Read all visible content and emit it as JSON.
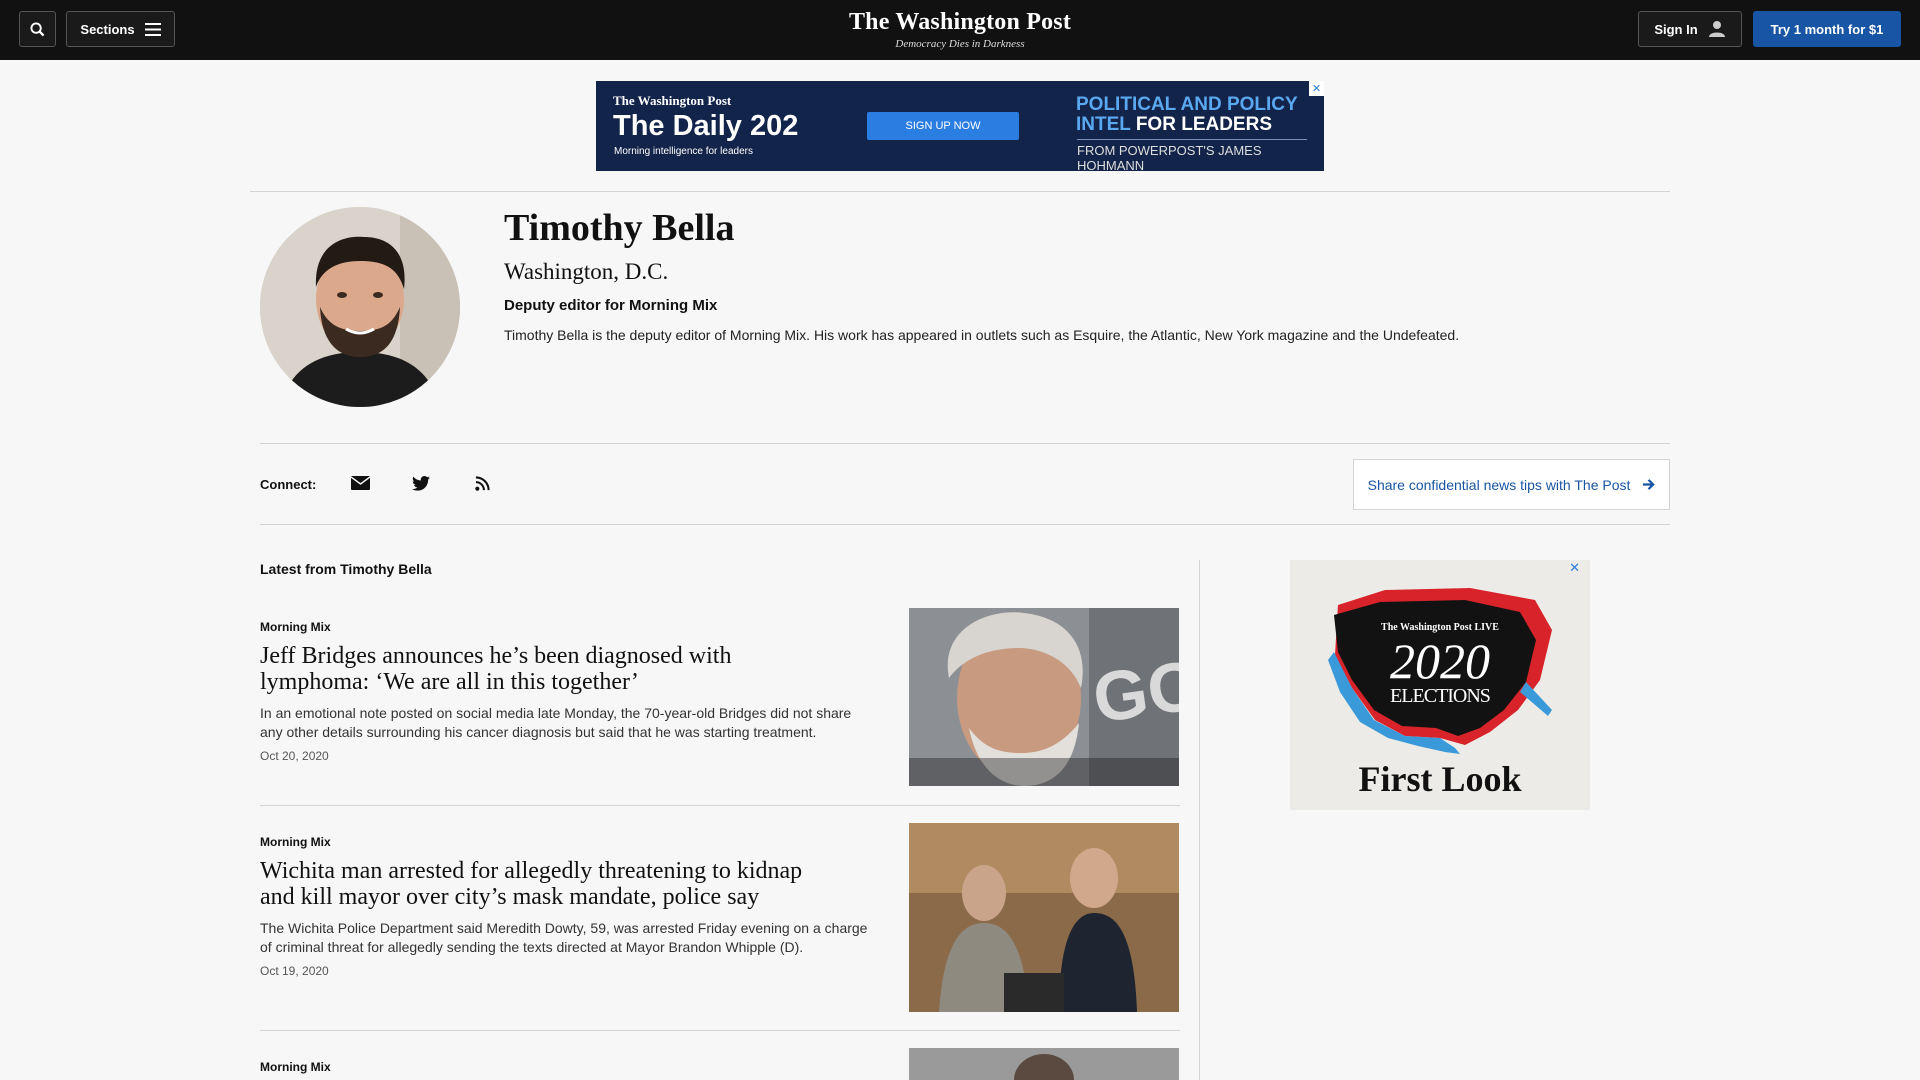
{
  "header": {
    "search_icon": "search-icon",
    "sections_label": "Sections",
    "logo_title": "The Washington Post",
    "logo_tagline": "Democracy Dies in Darkness",
    "signin_label": "Sign In",
    "trial_label": "Try 1 month for $1"
  },
  "ad_banner": {
    "brand": "The Washington Post",
    "title": "The Daily 202",
    "subtitle": "Morning intelligence for leaders",
    "cta": "SIGN UP NOW",
    "headline_blue": "POLITICAL AND POLICY INTEL",
    "headline_white": " FOR LEADERS",
    "byline": "FROM POWERPOST'S JAMES HOHMANN",
    "close": "✕"
  },
  "author": {
    "name": "Timothy Bella",
    "location": "Washington, D.C.",
    "role": "Deputy editor for Morning Mix",
    "bio": "Timothy Bella is the deputy editor of Morning Mix. His work has appeared in outlets such as Esquire, the Atlantic, New York magazine and the Undefeated."
  },
  "connect": {
    "label": "Connect:",
    "icons": [
      "email-icon",
      "twitter-icon",
      "rss-icon"
    ],
    "tips_label": "Share confidential news tips with The Post"
  },
  "latest": {
    "heading": "Latest from Timothy Bella",
    "articles": [
      {
        "kicker": "Morning Mix",
        "headline": "Jeff Bridges announces he’s been diagnosed with lymphoma: ‘We are all in this together’",
        "blurb": "In an emotional note posted on social media late Monday, the 70-year-old Bridges did not share any other details surrounding his cancer diagnosis but said that he was starting treatment.",
        "date": "Oct 20, 2020"
      },
      {
        "kicker": "Morning Mix",
        "headline": "Wichita man arrested for allegedly threatening to kidnap and kill mayor over city’s mask mandate, police say",
        "blurb": "The Wichita Police Department said Meredith Dowty, 59, was arrested Friday evening on a charge of criminal threat for allegedly sending the texts directed at Mayor Brandon Whipple (D).",
        "date": "Oct 19, 2020"
      },
      {
        "kicker": "Morning Mix"
      }
    ]
  },
  "side_ad": {
    "brand": "The Washington Post LIVE",
    "year": "2020",
    "label": "ELECTIONS",
    "title": "First Look",
    "close": "✕"
  },
  "colors": {
    "nav_bg": "#111111",
    "accent_blue": "#1955a5",
    "ad_navy": "#13244a"
  }
}
